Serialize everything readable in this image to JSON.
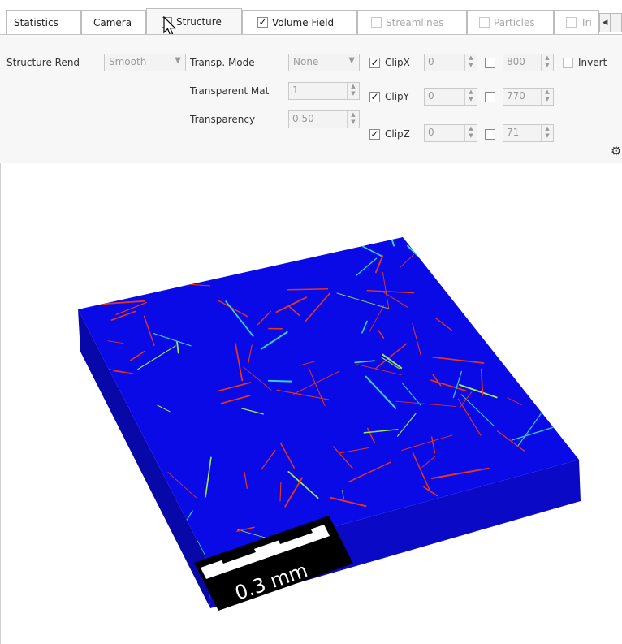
{
  "tabs": [
    {
      "label": "Statistics",
      "checkbox": false,
      "disabled": false
    },
    {
      "label": "Camera",
      "checkbox": false,
      "disabled": false
    },
    {
      "label": "Structure",
      "checkbox": true,
      "checked": false,
      "disabled": false,
      "active": true
    },
    {
      "label": "Volume Field",
      "checkbox": true,
      "checked": true,
      "disabled": false
    },
    {
      "label": "Streamlines",
      "checkbox": true,
      "checked": false,
      "disabled": true
    },
    {
      "label": "Particles",
      "checkbox": true,
      "checked": false,
      "disabled": true
    },
    {
      "label": "Tri",
      "checkbox": true,
      "checked": false,
      "disabled": true
    }
  ],
  "structure_panel": {
    "structure_rend_label": "Structure Rend",
    "structure_rend_value": "Smooth",
    "transp_mode_label": "Transp. Mode",
    "transp_mode_value": "None",
    "transparent_mat_label": "Transparent Mat",
    "transparent_mat_value": "1",
    "transparency_label": "Transparency",
    "transparency_value": "0.50",
    "clip": [
      {
        "label": "ClipX",
        "checked": true,
        "min": "0",
        "max_checked": false,
        "max": "800"
      },
      {
        "label": "ClipY",
        "checked": true,
        "min": "0",
        "max_checked": false,
        "max": "770"
      },
      {
        "label": "ClipZ",
        "checked": true,
        "min": "0",
        "max_checked": false,
        "max": "71"
      }
    ],
    "invert_label": "Invert",
    "invert_checked": false
  },
  "viewport": {
    "scale_bar_label": "0.3 mm",
    "volume_color": "#0a0ae6",
    "fiber_color": "#e8341c"
  },
  "icons": {
    "cursor": "mouse-pointer-icon",
    "settings": "gear-icon",
    "tab_scroll_left": "chevron-left-icon"
  }
}
